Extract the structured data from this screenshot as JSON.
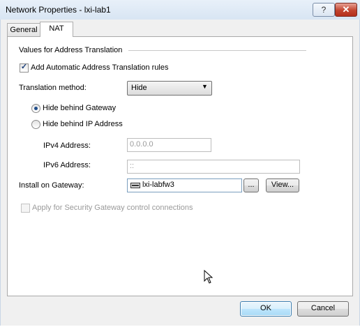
{
  "window": {
    "title": "Network Properties - lxi-lab1",
    "help_label": "?",
    "close_label": "✕"
  },
  "tabs": [
    {
      "label": "General",
      "active": false
    },
    {
      "label": "NAT",
      "active": true
    }
  ],
  "nat": {
    "group_title": "Values for Address Translation",
    "auto_rules": {
      "label": "Add Automatic Address Translation rules",
      "checked": true
    },
    "method": {
      "label": "Translation method:",
      "value": "Hide"
    },
    "radios": [
      {
        "label": "Hide behind Gateway",
        "selected": true
      },
      {
        "label": "Hide behind IP Address",
        "selected": false
      }
    ],
    "ipv4": {
      "label": "IPv4 Address:",
      "value": "0.0.0.0"
    },
    "ipv6": {
      "label": "IPv6 Address:",
      "value": "::"
    },
    "gateway": {
      "label": "Install on Gateway:",
      "value": "lxi-labfw3",
      "browse_label": "...",
      "view_label": "View..."
    },
    "security": {
      "label": "Apply for Security Gateway control connections",
      "checked": false,
      "enabled": false
    }
  },
  "footer": {
    "ok_label": "OK",
    "cancel_label": "Cancel"
  },
  "icons": {
    "gateway": "gateway-icon",
    "cursor": "mouse-pointer-icon"
  }
}
